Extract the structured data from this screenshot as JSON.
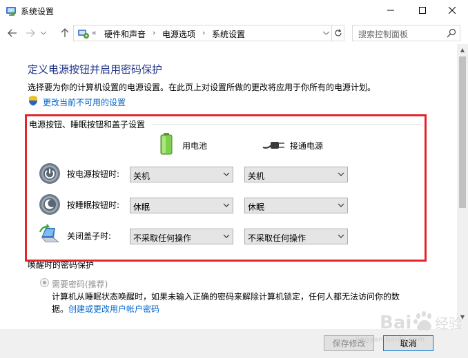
{
  "window": {
    "title": "系统设置"
  },
  "nav": {
    "breadcrumbs": [
      "硬件和声音",
      "电源选项",
      "系统设置"
    ],
    "crumb_prefix": "«",
    "search_placeholder": "搜索控制面板"
  },
  "main": {
    "heading": "定义电源按钮并启用密码保护",
    "description": "选择要为你的计算机设置的电源设置。在此页上对设置所做的更改将应用于你所有的电源计划。",
    "change_link": "更改当前不可用的设置",
    "group_title": "电源按钮、睡眠按钮和盖子设置",
    "columns": [
      "用电池",
      "接通电源"
    ],
    "rows": [
      {
        "label": "按电源按钮时:",
        "battery": "关机",
        "plugged": "关机"
      },
      {
        "label": "按睡眠按钮时:",
        "battery": "休眠",
        "plugged": "休眠"
      },
      {
        "label": "关闭盖子时:",
        "battery": "不采取任何操作",
        "plugged": "不采取任何操作"
      }
    ]
  },
  "password": {
    "title": "唤醒时的密码保护",
    "radio_label": "需要密码(推荐)",
    "desc_line1": "计算机从睡眠状态唤醒时，如果未输入正确的密码来解除计算机锁定，任何人都无法访问你的数",
    "desc_line2_prefix": "据。",
    "desc_link": "创建或更改用户帐户密码"
  },
  "footer": {
    "save_label": "保存修改",
    "cancel_label": "取消"
  },
  "watermark": {
    "text": "jingyan.baidu.com"
  },
  "colors": {
    "heading": "#1e3287",
    "link": "#0066cc",
    "highlight": "#e3242b"
  }
}
